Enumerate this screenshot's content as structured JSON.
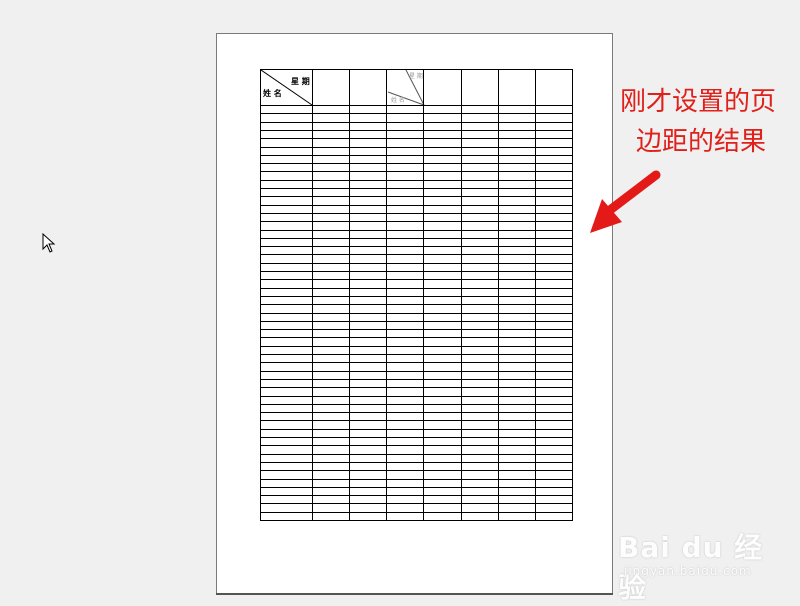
{
  "document": {
    "table": {
      "column_count": 8,
      "body_row_count": 50,
      "header_cell_1": {
        "top_right": "星 期",
        "bottom_left": "姓 名"
      },
      "header_cell_4": {
        "top_right": "星 期",
        "bottom_left": "姓 名"
      }
    }
  },
  "annotation": {
    "line1": "刚才设置的页",
    "line2": "边距的结果",
    "color": "#e0201a"
  },
  "watermark": {
    "main": "Bai du 经验",
    "sub": "jingyan.baidu.com"
  },
  "icons": {
    "cursor": "mouse-pointer-icon",
    "arrow": "red-arrow-icon"
  }
}
